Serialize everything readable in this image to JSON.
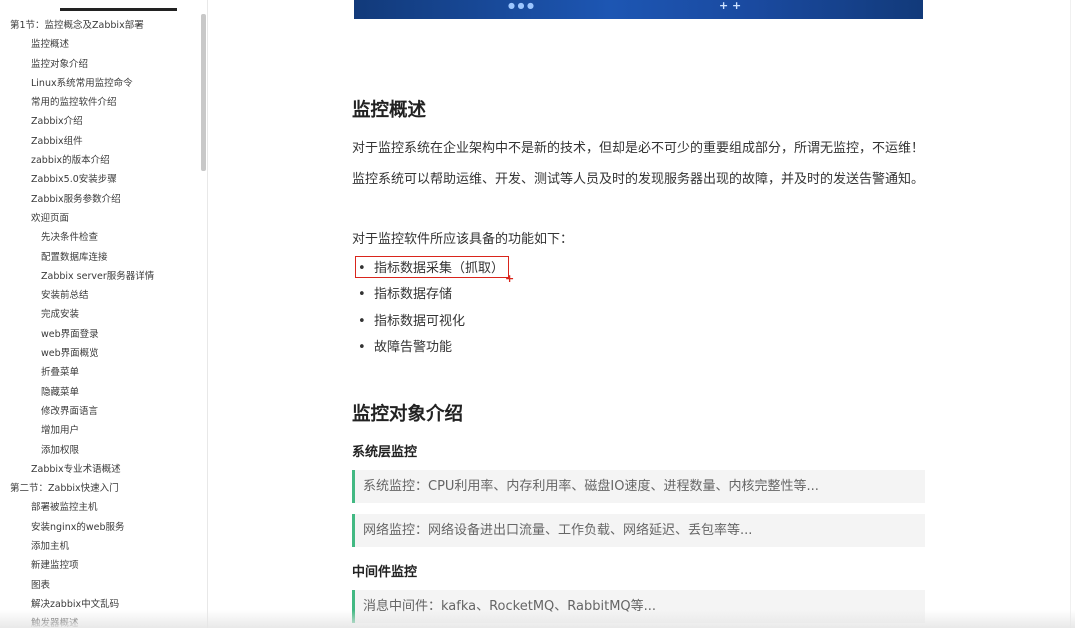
{
  "sidebar": {
    "items": [
      {
        "label": "第1节：监控概念及Zabbix部署",
        "level": 0
      },
      {
        "label": "监控概述",
        "level": 1
      },
      {
        "label": "监控对象介绍",
        "level": 1
      },
      {
        "label": "Linux系统常用监控命令",
        "level": 1
      },
      {
        "label": "常用的监控软件介绍",
        "level": 1
      },
      {
        "label": "Zabbix介绍",
        "level": 1
      },
      {
        "label": "Zabbix组件",
        "level": 1
      },
      {
        "label": "zabbix的版本介绍",
        "level": 1
      },
      {
        "label": "Zabbix5.0安装步骤",
        "level": 1
      },
      {
        "label": "Zabbix服务参数介绍",
        "level": 1
      },
      {
        "label": "欢迎页面",
        "level": 1
      },
      {
        "label": "先决条件检查",
        "level": 2
      },
      {
        "label": "配置数据库连接",
        "level": 2
      },
      {
        "label": "Zabbix server服务器详情",
        "level": 2
      },
      {
        "label": "安装前总结",
        "level": 2
      },
      {
        "label": "完成安装",
        "level": 2
      },
      {
        "label": "web界面登录",
        "level": 2
      },
      {
        "label": "web界面概览",
        "level": 2
      },
      {
        "label": "折叠菜单",
        "level": 2
      },
      {
        "label": "隐藏菜单",
        "level": 2
      },
      {
        "label": "修改界面语言",
        "level": 2
      },
      {
        "label": "增加用户",
        "level": 2
      },
      {
        "label": "添加权限",
        "level": 2
      },
      {
        "label": "Zabbix专业术语概述",
        "level": 1
      },
      {
        "label": "第二节：Zabbix快速入门",
        "level": 0
      },
      {
        "label": "部署被监控主机",
        "level": 1
      },
      {
        "label": "安装nginx的web服务",
        "level": 1
      },
      {
        "label": "添加主机",
        "level": 1
      },
      {
        "label": "新建监控项",
        "level": 1
      },
      {
        "label": "图表",
        "level": 1
      },
      {
        "label": "解决zabbix中文乱码",
        "level": 1
      },
      {
        "label": "触发器概述",
        "level": 1
      }
    ]
  },
  "content": {
    "section1": {
      "title": "监控概述",
      "p1": "对于监控系统在企业架构中不是新的技术，但却是必不可少的重要组成部分，所谓无监控，不运维！",
      "p2": "监控系统可以帮助运维、开发、测试等人员及时的发现服务器出现的故障，并及时的发送告警通知。",
      "p3": "对于监控软件所应该具备的功能如下：",
      "features": [
        "指标数据采集（抓取）",
        "指标数据存储",
        "指标数据可视化",
        "故障告警功能"
      ]
    },
    "section2": {
      "title": "监控对象介绍",
      "sub1": "系统层监控",
      "q1": "系统监控：CPU利用率、内存利用率、磁盘IO速度、进程数量、内核完整性等...",
      "q2": "网络监控：网络设备进出口流量、工作负载、网络延迟、丢包率等...",
      "sub2": "中间件监控",
      "q3": "消息中间件：kafka、RocketMQ、RabbitMQ等..."
    }
  },
  "colors": {
    "accent": "#42b983",
    "highlight": "#d9251c",
    "banner": "#1d56b3"
  }
}
